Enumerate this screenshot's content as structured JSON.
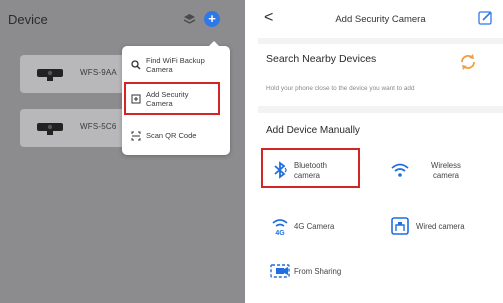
{
  "left": {
    "title": "Device",
    "devices": [
      {
        "name": "WFS-9AA"
      },
      {
        "name": "WFS-5C6"
      }
    ],
    "menu": [
      {
        "label_line1": "Find WiFi Backup",
        "label_line2": "Camera",
        "icon": "search-icon"
      },
      {
        "label_line1": "Add Security",
        "label_line2": "Camera",
        "icon": "add-box-icon"
      },
      {
        "label_line1": "Scan QR Code",
        "label_line2": "",
        "icon": "scan-icon"
      }
    ]
  },
  "right": {
    "title": "Add Security Camera",
    "back_glyph": "<",
    "search": {
      "title": "Search Nearby Devices",
      "subtitle": "Hold your phone close to the device you want to add"
    },
    "manual": {
      "title": "Add Device Manually",
      "options": [
        {
          "line1": "Bluetooth",
          "line2": "camera",
          "icon": "bluetooth-icon"
        },
        {
          "line1": "Wireless",
          "line2": "camera",
          "icon": "wifi-icon"
        },
        {
          "line1": "4G Camera",
          "line2": "",
          "icon": "4g-icon"
        },
        {
          "line1": "Wired camera",
          "line2": "",
          "icon": "wired-icon"
        },
        {
          "line1": "From Sharing",
          "line2": "",
          "icon": "sharing-icon"
        }
      ]
    }
  },
  "colors": {
    "accent": "#2f78e8",
    "highlight": "#d42525",
    "refresh": "#f0a040"
  }
}
